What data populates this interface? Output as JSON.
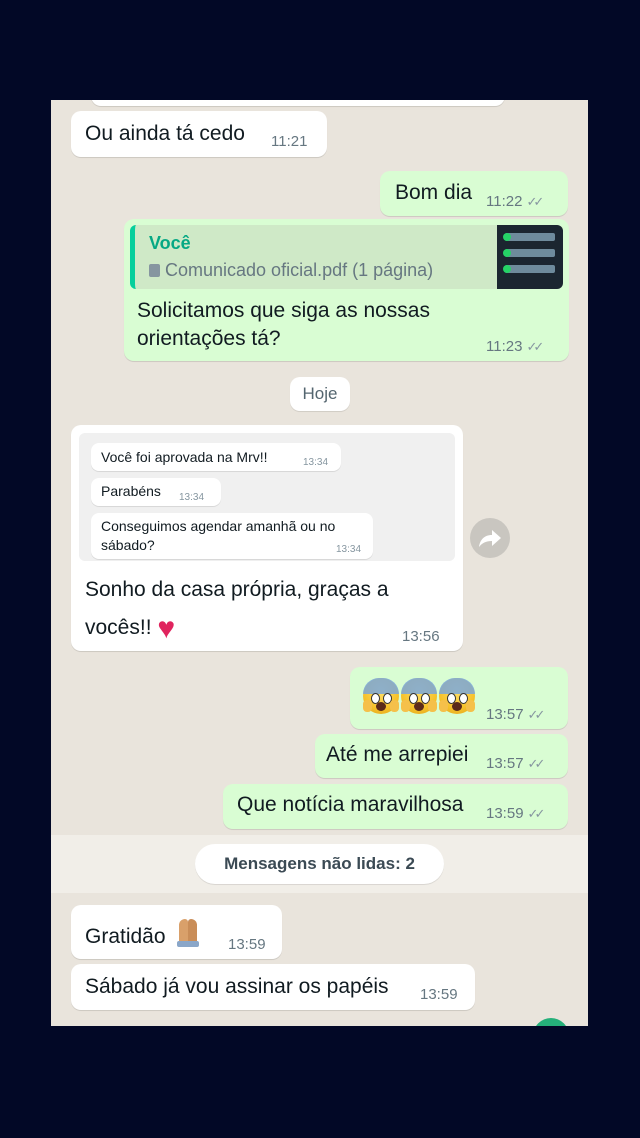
{
  "messages": {
    "m1": {
      "text": "Ou ainda tá cedo",
      "time": "11:21"
    },
    "m2": {
      "text": "Bom dia",
      "time": "11:22"
    },
    "m3": {
      "quote_author": "Você",
      "quote_file": "Comunicado oficial.pdf (1 página)",
      "line1": "Solicitamos que siga as nossas",
      "line2": "orientações tá?",
      "time": "11:23"
    },
    "m4": {
      "forwarded": [
        {
          "text": "Você foi aprovada na Mrv!!",
          "time": "13:34"
        },
        {
          "text": "Parabéns",
          "time": "13:34"
        },
        {
          "line1": "Conseguimos agendar amanhã ou no",
          "line2": "sábado?",
          "time": "13:34"
        }
      ],
      "line1": "Sonho da casa própria, graças a",
      "line2": "vocês!!",
      "time": "13:56"
    },
    "m5": {
      "time": "13:57"
    },
    "m6": {
      "text": "Até me arrepiei",
      "time": "13:57"
    },
    "m7": {
      "text": "Que notícia maravilhosa",
      "time": "13:59"
    },
    "m8": {
      "text": "Gratidão",
      "time": "13:59"
    },
    "m9": {
      "text": "Sábado já vou assinar os papéis",
      "time": "13:59"
    }
  },
  "date_pill": "Hoje",
  "unread_banner": "Mensagens não lidas: 2",
  "icons": {
    "read_ticks": "double-check-icon",
    "forward": "forward-icon",
    "heart": "red-heart-emoji",
    "scream": "face-screaming-emoji",
    "pray": "folded-hands-emoji",
    "pdf": "document-icon"
  },
  "colors": {
    "background": "#020826",
    "chat_bg": "#e9e4dc",
    "outgoing": "#d9fdd3",
    "incoming": "#ffffff",
    "accent": "#06cf9c"
  }
}
